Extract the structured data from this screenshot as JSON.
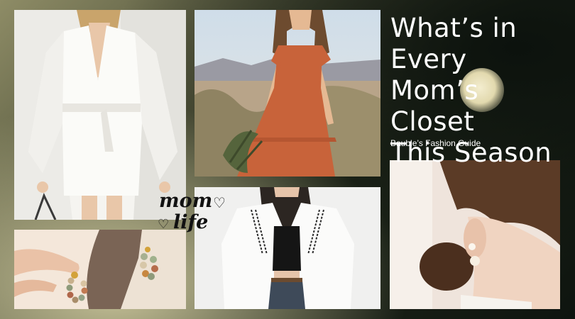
{
  "title_lines": [
    "What’s in Every",
    "Mom’s Closet",
    "This Season"
  ],
  "subtitle": "Bauble’s Fashion Guide",
  "stamp": {
    "line1": "mom",
    "line2": "life",
    "heart": "♡"
  },
  "photos": [
    {
      "name": "white-kimono-set-photo"
    },
    {
      "name": "rust-dress-desert-photo"
    },
    {
      "name": "beaded-hoop-earring-photo"
    },
    {
      "name": "white-embroidered-shirt-photo"
    },
    {
      "name": "pearl-earring-photo"
    }
  ],
  "colors": {
    "title": "#ffffff",
    "dress": "#c8633a",
    "background_dark": "#0e140f",
    "background_light": "#c9c49a"
  }
}
